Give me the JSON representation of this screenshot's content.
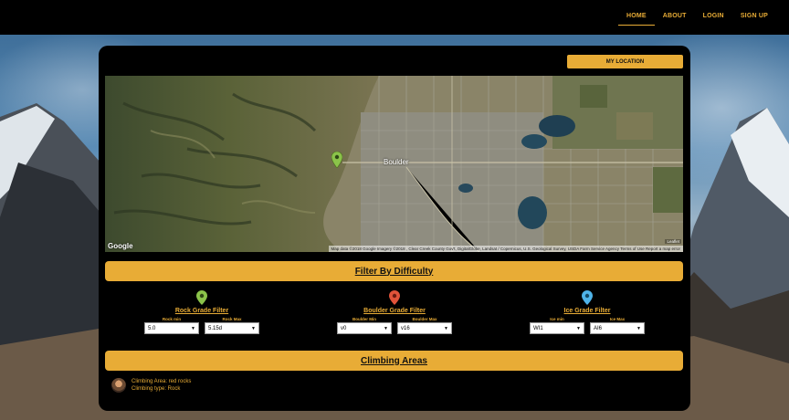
{
  "nav": {
    "links": [
      "HOME",
      "ABOUT",
      "LOGIN",
      "SIGN UP"
    ],
    "active": "HOME",
    "accent_color": "#e8ac36"
  },
  "map": {
    "my_location_label": "MY LOCATION",
    "city_label": "Boulder",
    "google_label": "Google",
    "leaflet_label": "Leaflet",
    "attribution": "Map data ©2018 Google Imagery ©2018 , Clear Creek County Gov't, DigitalGlobe, Landsat / Copernicus, U.S. Geological Survey, USDA Farm Service Agency   Terms of Use   Report a map error",
    "marker_icon": "map-marker-green-icon"
  },
  "filter": {
    "heading": "Filter By Difficulty",
    "columns": [
      {
        "title": "Rock Grade Filter",
        "pin_color": "#8bc34a",
        "min_label": "Rock min",
        "max_label": "Rock Max",
        "min_value": "5.0",
        "max_value": "5.15d"
      },
      {
        "title": "Boulder Grade Filter",
        "pin_color": "#e0533a",
        "min_label": "Boulder Min",
        "max_label": "Boulder Max",
        "min_value": "v0",
        "max_value": "v16"
      },
      {
        "title": "Ice Grade Filter",
        "pin_color": "#4fb3e8",
        "min_label": "Ice min",
        "max_label": "Ice Max",
        "min_value": "WI1",
        "max_value": "AI6"
      }
    ]
  },
  "areas": {
    "heading": "Climbing Areas",
    "items": [
      {
        "area": "Climbing Area: red rocks",
        "type": "Climbing type: Rock"
      }
    ]
  }
}
